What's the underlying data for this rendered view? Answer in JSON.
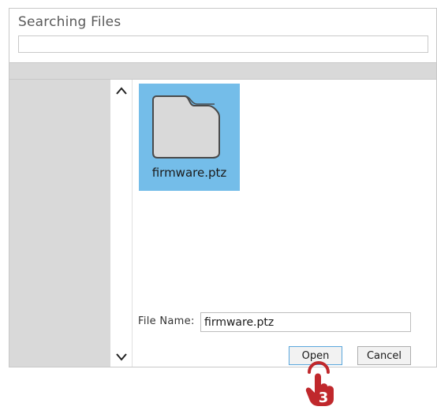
{
  "dialog": {
    "title": "Searching Files",
    "path_value": ""
  },
  "file_list": {
    "items": [
      {
        "label": "firmware.ptz",
        "icon": "folder-icon",
        "selected": true
      }
    ]
  },
  "scrollbar": {
    "up_icon": "chevron-up-icon",
    "down_icon": "chevron-down-icon"
  },
  "file_name": {
    "label": "File Name:",
    "value": "firmware.ptz"
  },
  "buttons": {
    "open_label": "Open",
    "cancel_label": "Cancel"
  },
  "cursor": {
    "icon": "hand-pointer-icon",
    "step_number": "3",
    "color": "#c0282c"
  },
  "colors": {
    "selection": "#74bde9",
    "pane": "#d9d9d9"
  }
}
